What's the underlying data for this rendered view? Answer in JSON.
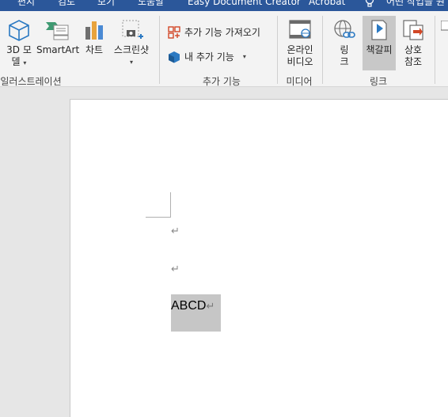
{
  "tabs": [
    {
      "label": "편지"
    },
    {
      "label": "검토"
    },
    {
      "label": "보기"
    },
    {
      "label": "도움말"
    },
    {
      "label": "Easy Document Creator"
    },
    {
      "label": "Acrobat"
    },
    {
      "label": "어떤 작업을 원"
    }
  ],
  "ribbon": {
    "illustrations": {
      "model3d": {
        "line1": "3D 모",
        "line2": "델"
      },
      "smartart": "SmartArt",
      "chart": "차트",
      "screenshot": "스크린샷",
      "group_label": "일러스트레이션"
    },
    "addins": {
      "get_addins": "추가 기능 가져오기",
      "my_addins": "내 추가 기능",
      "group_label": "추가 기능"
    },
    "media": {
      "online_video": {
        "line1": "온라인",
        "line2": "비디오"
      },
      "group_label": "미디어"
    },
    "links": {
      "link": {
        "line1": "링",
        "line2": "크"
      },
      "bookmark": "책갈피",
      "cross_ref": {
        "line1": "상호",
        "line2": "참조"
      },
      "group_label": "링크"
    }
  },
  "document": {
    "paragraph_mark": "↵",
    "selected_text": "ABCD"
  },
  "colors": {
    "accent": "#2b579a",
    "selection": "#c6c6c6",
    "ribbon_bg": "#f3f3f3"
  }
}
